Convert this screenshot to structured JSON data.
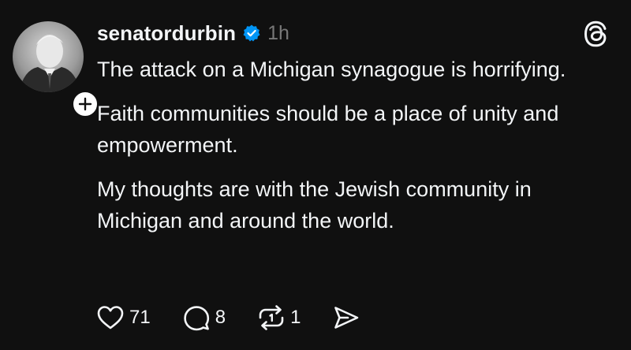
{
  "post": {
    "username": "senatordurbin",
    "timestamp": "1h",
    "paragraphs": [
      "The attack on a Michigan synagogue is horrifying.",
      "Faith communities should be a place of unity and empowerment.",
      "My thoughts are with the Jewish community in Michigan and around the world."
    ]
  },
  "actions": {
    "like_count": "71",
    "reply_count": "8",
    "repost_count": "1"
  },
  "icons": {
    "verified": "verified-badge-icon",
    "threads": "threads-logo-icon",
    "like": "heart-icon",
    "reply": "speech-bubble-icon",
    "repost": "repost-icon",
    "share": "send-icon",
    "follow": "plus-icon"
  },
  "colors": {
    "background": "#101010",
    "text": "#f3f5f7",
    "muted": "#777777",
    "verified": "#0095f6"
  }
}
